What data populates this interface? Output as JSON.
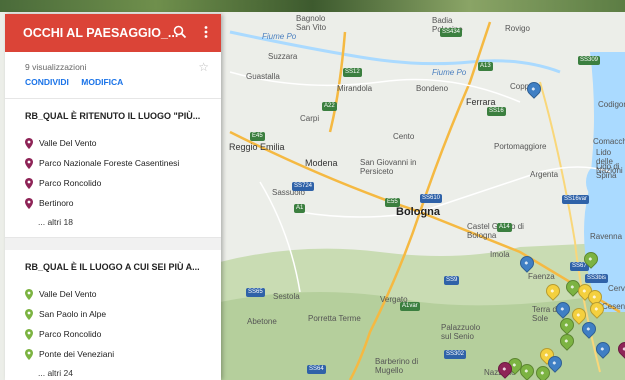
{
  "colors": {
    "header": "#db4437",
    "pin_purple": "#8e2457",
    "pin_green": "#7cb342",
    "pin_yellow": "#f4d03f",
    "pin_blue": "#3f7fc4"
  },
  "panel": {
    "title": "OCCHI AL PAESAGGIO_...",
    "views": "9 visualizzazioni",
    "share_label": "CONDIVIDI",
    "edit_label": "MODIFICA"
  },
  "layers": [
    {
      "title": "RB_QUAL È RITENUTO IL LUOGO \"PIÙ...",
      "items": [
        "Valle Del Vento",
        "Parco Nazionale Foreste Casentinesi",
        "Parco Roncolido",
        "Bertinoro"
      ],
      "more": "... altri 18"
    },
    {
      "title": "RB_QUAL È IL LUOGO A CUI SEI PIÙ A...",
      "items": [
        "Valle Del Vento",
        "San Paolo in Alpe",
        "Parco Roncolido",
        "Ponte dei Veneziani"
      ],
      "more": "... altri 24"
    }
  ],
  "map": {
    "cities": [
      "Bologna",
      "Modena",
      "Ferrara",
      "Reggio Emilia"
    ],
    "towns": [
      "Carpi",
      "Sassuolo",
      "Imola",
      "Faenza",
      "Ravenna",
      "Cento",
      "Rovigo",
      "Bondeno",
      "Mirandola",
      "Suzzara",
      "Guastalla",
      "Codigoro",
      "Comacchio",
      "Portomaggiore",
      "Argenta",
      "San Giovanni in Persiceto",
      "Castel Guelfo di Bologna",
      "Sestola",
      "Abetone",
      "Porretta Terme",
      "Vergato",
      "Palazzuolo sul Senio",
      "Barberino di Mugello",
      "Badia Polesine",
      "Bagnolo San Vito",
      "Lido delle Nazioni",
      "Lido di Spina",
      "Cervia",
      "Cesenatico",
      "Terra del Sole",
      "Copparo",
      "Nazzano"
    ],
    "rivers": [
      "Fiume Po",
      "Fiume Po"
    ],
    "roads": [
      "SS434",
      "SS309",
      "SS12",
      "A13",
      "A22",
      "SS16",
      "E45",
      "A1",
      "A14",
      "SS9",
      "SS724",
      "SS64",
      "SS65",
      "SS67",
      "SS302",
      "SS610",
      "SS16var",
      "E55",
      "SS3bis",
      "A1var"
    ]
  }
}
